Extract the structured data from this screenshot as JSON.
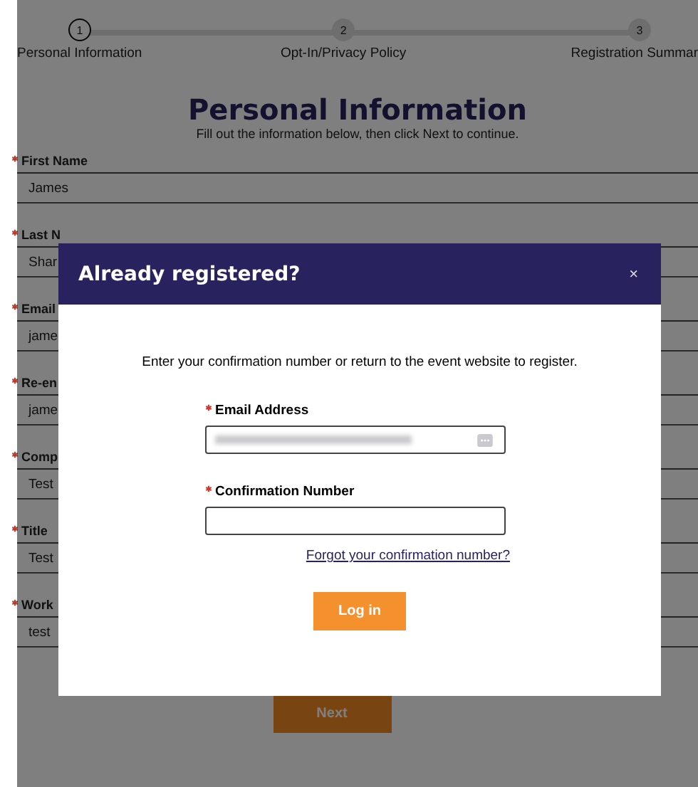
{
  "stepper": [
    {
      "number": "1",
      "label": "Personal Information",
      "selected": true
    },
    {
      "number": "2",
      "label": "Opt-In/Privacy Policy",
      "selected": false
    },
    {
      "number": "3",
      "label": "Registration Summar",
      "selected": false
    }
  ],
  "page": {
    "title": "Personal Information",
    "subtitle": "Fill out the information below, then click Next to continue.",
    "fields": [
      {
        "label": "First Name",
        "value": "James",
        "required": true
      },
      {
        "label": "Last N",
        "value": "Shar",
        "required": true
      },
      {
        "label": "Email",
        "value": "jame",
        "required": true
      },
      {
        "label": "Re-en",
        "value": "jame",
        "required": true
      },
      {
        "label": "Comp",
        "value": "Test",
        "required": true
      },
      {
        "label": "Title",
        "value": "Test",
        "required": true
      }
    ],
    "split_field": {
      "label": "Work",
      "value": "test",
      "required": true
    },
    "next_button": "Next"
  },
  "modal": {
    "title": "Already registered?",
    "close": "×",
    "message": "Enter your confirmation number or return to the event website to register.",
    "fields": [
      {
        "label": "Email Address",
        "required": true,
        "obscured": true
      },
      {
        "label": "Confirmation Number",
        "required": true,
        "obscured": false
      }
    ],
    "link": "Forgot your confirmation number?",
    "button": "Log in"
  }
}
